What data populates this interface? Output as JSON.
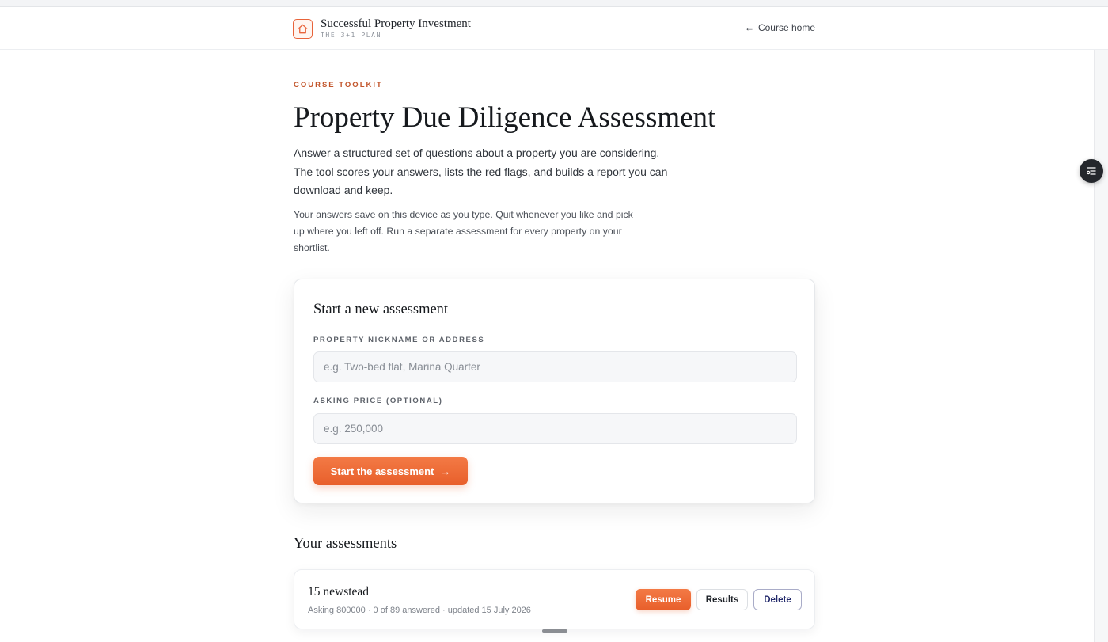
{
  "header": {
    "brand_title": "Successful Property Investment",
    "brand_subtitle": "THE 3+1 PLAN",
    "logo_icon": "house-icon",
    "course_home_label": "Course home",
    "back_icon": "arrow-left-icon"
  },
  "hero": {
    "eyebrow": "COURSE TOOLKIT",
    "title": "Property Due Diligence Assessment",
    "intro": "Answer a structured set of questions about a property you are considering. The tool scores your answers, lists the red flags, and builds a report you can download and keep.",
    "note": "Your answers save on this device as you type. Quit whenever you like and pick up where you left off. Run a separate assessment for every property on your shortlist."
  },
  "new_assessment": {
    "title": "Start a new assessment",
    "nickname_label": "PROPERTY NICKNAME OR ADDRESS",
    "nickname_value": "",
    "nickname_placeholder": "e.g. Two-bed flat, Marina Quarter",
    "price_label": "ASKING PRICE (OPTIONAL)",
    "price_value": "",
    "price_placeholder": "e.g. 250,000",
    "start_label": "Start the assessment",
    "start_icon": "arrow-right-icon"
  },
  "assessments": {
    "title": "Your assessments",
    "items": [
      {
        "name": "15 newstead",
        "meta": "Asking 800000 · 0 of 89 answered · updated 15 July 2026",
        "resume_label": "Resume",
        "results_label": "Results",
        "delete_label": "Delete"
      }
    ]
  },
  "side_fab_icon": "list-settings-icon",
  "colors": {
    "accent": "#e8633a",
    "eyebrow": "#c2552b",
    "delete_text": "#232a6b"
  }
}
